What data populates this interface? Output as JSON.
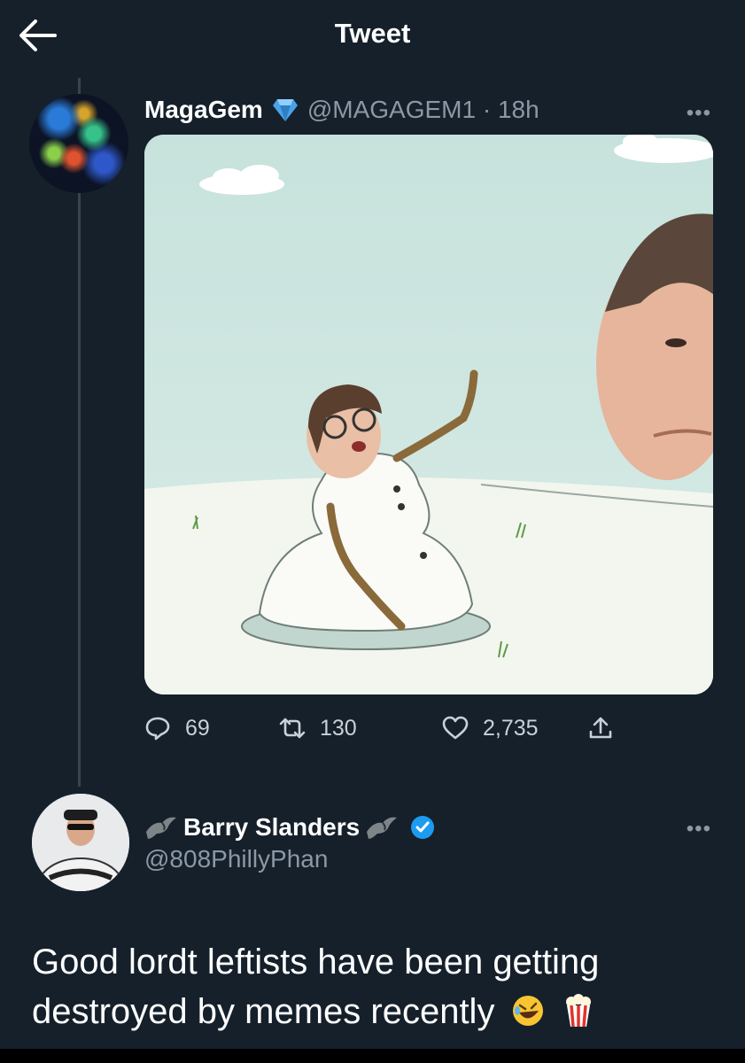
{
  "header": {
    "back_icon": "arrow-left-icon",
    "title": "Tweet"
  },
  "tweet": {
    "author_name": "MagaGem",
    "badge_icon": "diamond-icon",
    "handle_time": "@MAGAGEM1 · 18h",
    "more_label": "•••",
    "actions": {
      "replies": "69",
      "retweets": "130",
      "likes": "2,735"
    }
  },
  "reply": {
    "author_name": "Barry Slanders",
    "handle": "@808PhillyPhan",
    "more_label": "•••",
    "text": "Good lordt leftists have been getting destroyed by memes recently",
    "emojis": [
      "rolling-laughing-emoji",
      "popcorn-emoji"
    ]
  },
  "colors": {
    "background": "#15202b",
    "secondary_text": "#8b98a5",
    "verified": "#1d9bf0",
    "diamond": "#4aa3e8"
  }
}
